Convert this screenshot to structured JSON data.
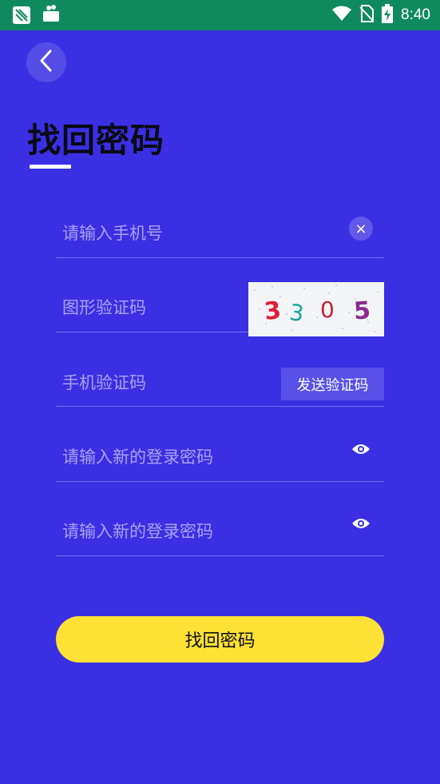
{
  "status_bar": {
    "time": "8:40",
    "icons": [
      "app-notification-icon",
      "bag-icon",
      "wifi-icon",
      "no-sim-icon",
      "battery-charging-icon"
    ]
  },
  "page": {
    "title": "找回密码",
    "back_icon": "chevron-left-icon"
  },
  "form": {
    "phone": {
      "placeholder": "请输入手机号",
      "value": "",
      "clear_icon": "×"
    },
    "captcha": {
      "placeholder": "图形验证码",
      "value": "",
      "image_text": "3305"
    },
    "sms_code": {
      "placeholder": "手机验证码",
      "value": "",
      "send_label": "发送验证码"
    },
    "new_password": {
      "placeholder": "请输入新的登录密码",
      "value": "",
      "toggle_icon": "eye-icon"
    },
    "confirm_password": {
      "placeholder": "请输入新的登录密码",
      "value": "",
      "toggle_icon": "eye-icon"
    }
  },
  "submit": {
    "label": "找回密码"
  },
  "colors": {
    "background": "#3a2fe3",
    "status_bar": "#0f8a5f",
    "submit": "#fde135",
    "title": "#0a0a14"
  }
}
